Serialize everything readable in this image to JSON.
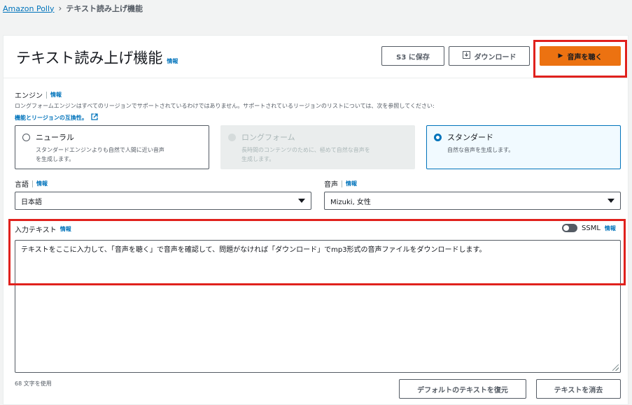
{
  "breadcrumb": {
    "root": "Amazon Polly",
    "current": "テキスト読み上げ機能"
  },
  "header": {
    "title": "テキスト読み上げ機能",
    "info": "情報",
    "save_s3": "S3 に保存",
    "download": "ダウンロード",
    "listen": "音声を聴く"
  },
  "engine": {
    "label": "エンジン",
    "info": "情報",
    "description": "ロングフォームエンジンはすべてのリージョンでサポートされているわけではありません。サポートされているリージョンのリストについては、次を参照してください:",
    "compat_link": "機能とリージョンの互換性。",
    "options": [
      {
        "title": "ニューラル",
        "desc1": "スタンダードエンジンよりも自然で人間に近い音声",
        "desc2": "を生成します。",
        "state": "unselected"
      },
      {
        "title": "ロングフォーム",
        "desc1": "長時間のコンテンツのために、極めて自然な音声を",
        "desc2": "生成します。",
        "state": "disabled"
      },
      {
        "title": "スタンダード",
        "desc1": "自然な音声を生成します。",
        "desc2": "",
        "state": "selected"
      }
    ]
  },
  "language": {
    "label": "言語",
    "info": "情報",
    "value": "日本語"
  },
  "voice": {
    "label": "音声",
    "info": "情報",
    "value": "Mizuki, 女性"
  },
  "input": {
    "label": "入力テキスト",
    "info": "情報",
    "ssml_label": "SSML",
    "ssml_info": "情報",
    "text": "テキストをここに入力して、「音声を聴く」で音声を確認して、問題がなければ「ダウンロード」でmp3形式の音声ファイルをダウンロードします。",
    "char_count": "68 文字を使用",
    "restore_default": "デフォルトのテキストを復元",
    "clear_text": "テキストを消去"
  },
  "colors": {
    "accent": "#ec7211",
    "highlight": "#e0211d",
    "link": "#0073bb"
  }
}
